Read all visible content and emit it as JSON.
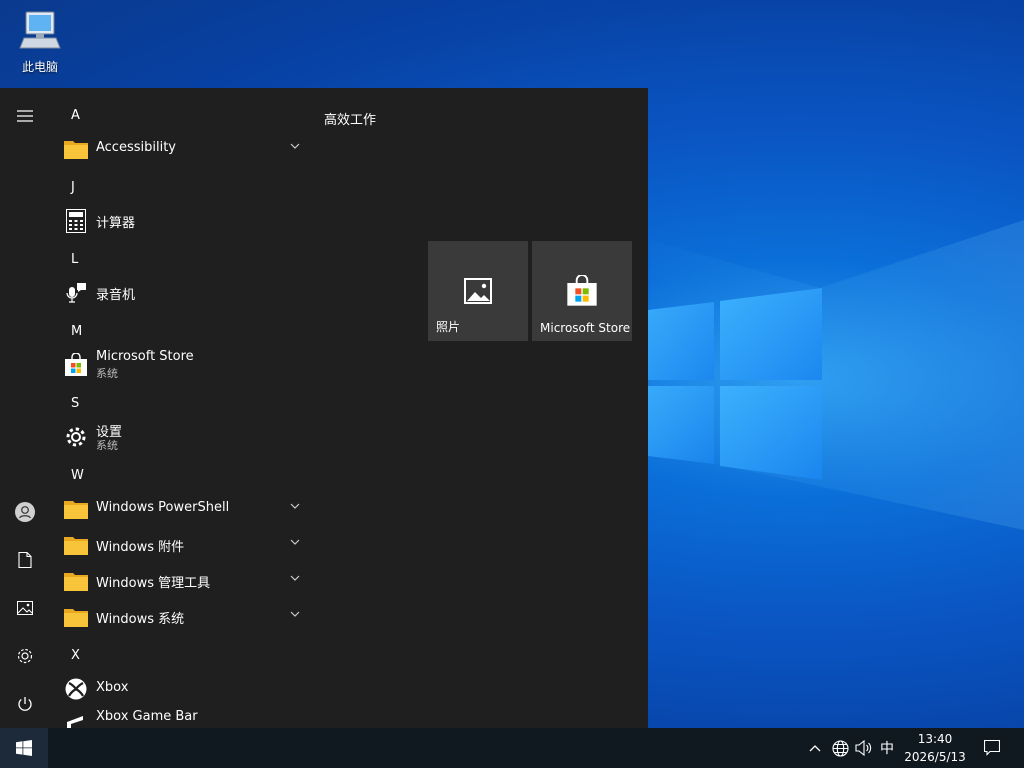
{
  "desktop": {
    "icon_label": "此电脑"
  },
  "start_menu": {
    "rail": {
      "icons": [
        "hamburger-menu-icon",
        "user-avatar-icon",
        "documents-icon",
        "pictures-icon",
        "settings-icon",
        "power-icon"
      ]
    },
    "letters": {
      "a": "A",
      "j": "J",
      "l": "L",
      "m": "M",
      "s": "S",
      "w": "W",
      "x": "X"
    },
    "apps": {
      "accessibility": "Accessibility",
      "calculator": "计算器",
      "recorder": "录音机",
      "store": "Microsoft Store",
      "store_sub": "系统",
      "settings": "设置",
      "settings_sub": "系统",
      "powershell": "Windows PowerShell",
      "accessories": "Windows 附件",
      "admin_tools": "Windows 管理工具",
      "system": "Windows 系统",
      "xbox": "Xbox",
      "xbox_game_bar": "Xbox Game Bar"
    },
    "tiles": {
      "group_title": "高效工作",
      "photos": "照片",
      "store": "Microsoft Store"
    }
  },
  "taskbar": {
    "ime": "中",
    "time": "13:40",
    "date": "2026/5/13"
  },
  "colors": {
    "start_bg": "#1f1f1f",
    "tile_bg": "#3a3a3a",
    "taskbar_bg": "#101820",
    "folder_yellow": "#f8c53a"
  }
}
